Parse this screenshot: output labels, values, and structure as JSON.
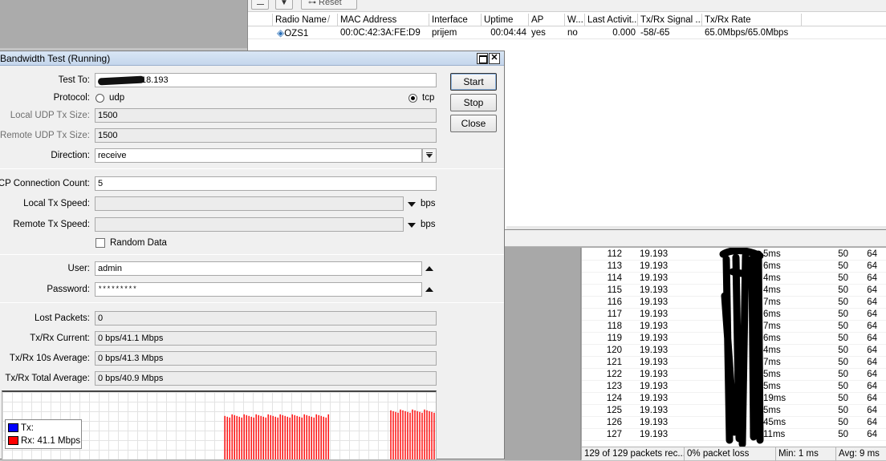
{
  "registration": {
    "toolbar": {
      "reset_label": "Reset"
    },
    "columns": [
      "Radio Name",
      "MAC Address",
      "Interface",
      "Uptime",
      "AP",
      "W...",
      "Last Activit...",
      "Tx/Rx Signal ...",
      "Tx/Rx Rate"
    ],
    "sort_indicator": "/",
    "row": {
      "radio_name": "OZS1",
      "mac": "00:0C:42:3A:FE:D9",
      "interface": "prijem",
      "uptime": "00:04:44",
      "ap": "yes",
      "wds": "no",
      "last_activity": "0.000",
      "signal": "-58/-65",
      "rate": "65.0Mbps/65.0Mbps"
    }
  },
  "bandwidth_test": {
    "title": "Bandwidth Test (Running)",
    "labels": {
      "test_to": "Test To:",
      "protocol": "Protocol:",
      "local_udp": "Local UDP Tx Size:",
      "remote_udp": "Remote UDP Tx Size:",
      "direction": "Direction:",
      "tcp_count": "TCP Connection Count:",
      "local_tx": "Local Tx Speed:",
      "remote_tx": "Remote Tx Speed:",
      "user": "User:",
      "password": "Password:",
      "lost": "Lost Packets:",
      "current": "Tx/Rx Current:",
      "avg10": "Tx/Rx 10s Average:",
      "total": "Tx/Rx Total Average:"
    },
    "values": {
      "test_to_suffix": "18.193",
      "protocol_udp": "udp",
      "protocol_tcp": "tcp",
      "protocol_selected": "tcp",
      "local_udp": "1500",
      "remote_udp": "1500",
      "direction": "receive",
      "tcp_count": "5",
      "unit_bps": "bps",
      "random_data": "Random Data",
      "user": "admin",
      "password": "*********",
      "lost": "0",
      "current": "0 bps/41.1 Mbps",
      "avg10": "0 bps/41.3 Mbps",
      "total": "0 bps/40.9 Mbps"
    },
    "buttons": {
      "start": "Start",
      "stop": "Stop",
      "close": "Close"
    },
    "legend": {
      "tx": "Tx:",
      "rx": "Rx:  41.1 Mbps",
      "tx_color": "#0000ff",
      "rx_color": "#ff0000"
    }
  },
  "chart_data": {
    "type": "bar",
    "series": [
      {
        "name": "Rx",
        "color": "#ff0000",
        "segments": [
          {
            "start": 0.512,
            "end": 0.755,
            "level": 0.65
          },
          {
            "start": 0.895,
            "end": 1.0,
            "level": 0.72
          }
        ]
      }
    ]
  },
  "ping": {
    "rows": [
      {
        "seq": "112",
        "host": "19.193",
        "time": "5ms",
        "size": "50",
        "ttl": "64"
      },
      {
        "seq": "113",
        "host": "19.193",
        "time": "6ms",
        "size": "50",
        "ttl": "64"
      },
      {
        "seq": "114",
        "host": "19.193",
        "time": "4ms",
        "size": "50",
        "ttl": "64"
      },
      {
        "seq": "115",
        "host": "19.193",
        "time": "4ms",
        "size": "50",
        "ttl": "64"
      },
      {
        "seq": "116",
        "host": "19.193",
        "time": "7ms",
        "size": "50",
        "ttl": "64"
      },
      {
        "seq": "117",
        "host": "19.193",
        "time": "6ms",
        "size": "50",
        "ttl": "64"
      },
      {
        "seq": "118",
        "host": "19.193",
        "time": "7ms",
        "size": "50",
        "ttl": "64"
      },
      {
        "seq": "119",
        "host": "19.193",
        "time": "6ms",
        "size": "50",
        "ttl": "64"
      },
      {
        "seq": "120",
        "host": "19.193",
        "time": "4ms",
        "size": "50",
        "ttl": "64"
      },
      {
        "seq": "121",
        "host": "19.193",
        "time": "7ms",
        "size": "50",
        "ttl": "64"
      },
      {
        "seq": "122",
        "host": "19.193",
        "time": "5ms",
        "size": "50",
        "ttl": "64"
      },
      {
        "seq": "123",
        "host": "19.193",
        "time": "5ms",
        "size": "50",
        "ttl": "64"
      },
      {
        "seq": "124",
        "host": "19.193",
        "time": "19ms",
        "size": "50",
        "ttl": "64"
      },
      {
        "seq": "125",
        "host": "19.193",
        "time": "5ms",
        "size": "50",
        "ttl": "64"
      },
      {
        "seq": "126",
        "host": "19.193",
        "time": "45ms",
        "size": "50",
        "ttl": "64"
      },
      {
        "seq": "127",
        "host": "19.193",
        "time": "11ms",
        "size": "50",
        "ttl": "64"
      }
    ],
    "status": {
      "received": "129 of 129 packets rec...",
      "loss": "0% packet loss",
      "min": "Min: 1 ms",
      "avg": "Avg: 9 ms"
    }
  }
}
